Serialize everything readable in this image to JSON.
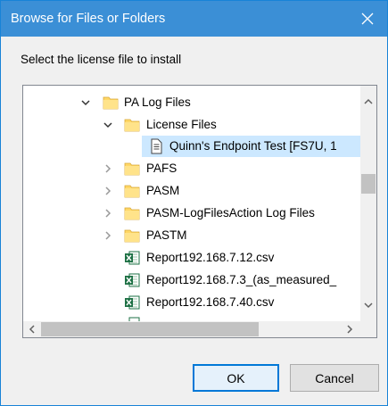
{
  "dialog": {
    "title": "Browse for Files or Folders",
    "prompt": "Select the license file to install",
    "ok_label": "OK",
    "cancel_label": "Cancel"
  },
  "tree": {
    "items": [
      {
        "label": "PA Log Files",
        "type": "folder",
        "state": "expanded"
      },
      {
        "label": "License Files",
        "type": "folder",
        "state": "expanded"
      },
      {
        "label": "Quinn's Endpoint Test [FS7U, 1",
        "type": "file",
        "selected": true
      },
      {
        "label": "PAFS",
        "type": "folder",
        "state": "collapsed"
      },
      {
        "label": "PASM",
        "type": "folder",
        "state": "collapsed"
      },
      {
        "label": "PASM-LogFilesAction Log Files",
        "type": "folder",
        "state": "collapsed"
      },
      {
        "label": "PASTM",
        "type": "folder",
        "state": "collapsed"
      },
      {
        "label": "Report192.168.7.12.csv",
        "type": "excel-file"
      },
      {
        "label": "Report192.168.7.3_(as_measured_",
        "type": "excel-file"
      },
      {
        "label": "Report192.168.7.40.csv",
        "type": "excel-file"
      }
    ]
  },
  "colors": {
    "titlebar": "#3b8fd6",
    "selection": "#cce8ff",
    "folder": "#ffd766",
    "excel": "#1e7145",
    "primary_border": "#0078d7"
  },
  "icons": {
    "close": "close-icon",
    "folder": "folder-icon",
    "file": "document-icon",
    "excel": "excel-icon",
    "expanded": "chevron-down-icon",
    "collapsed": "chevron-right-icon"
  }
}
